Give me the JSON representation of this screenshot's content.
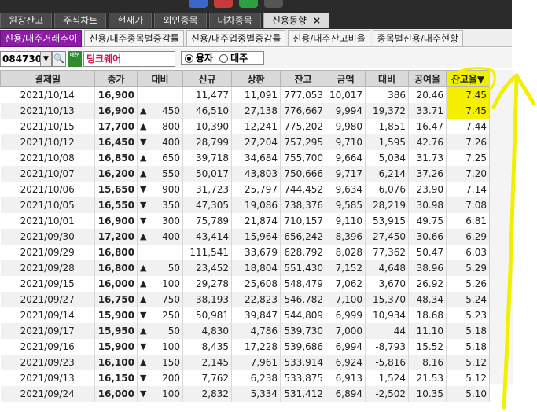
{
  "top_tabs": [
    {
      "label": "원장잔고",
      "active": false
    },
    {
      "label": "주식차트",
      "active": false
    },
    {
      "label": "현재가",
      "active": false
    },
    {
      "label": "외인종목",
      "active": false
    },
    {
      "label": "대차종목",
      "active": false
    },
    {
      "label": "신용동향",
      "active": true,
      "close": "×"
    }
  ],
  "sub_tabs": [
    {
      "label": "신용/대주거래추이",
      "active": true
    },
    {
      "label": "신용/대주종목별증감률",
      "active": false
    },
    {
      "label": "신용/대주업종별증감률",
      "active": false
    },
    {
      "label": "신용/대주잔고비율",
      "active": false
    },
    {
      "label": "종목별신용/대주현황",
      "active": false
    }
  ],
  "search": {
    "code": "084730",
    "dropdown_glyph": "▼",
    "search_glyph": "🔍",
    "badge_text": "배분",
    "stock_name": "팅크웨어",
    "radio_options": [
      {
        "label": "융자",
        "selected": true
      },
      {
        "label": "대주",
        "selected": false
      }
    ]
  },
  "table": {
    "headers": [
      "결제일",
      "종가",
      "대비",
      "신규",
      "상환",
      "잔고",
      "금액",
      "대비",
      "공여율",
      "잔고율▼"
    ],
    "rows": [
      {
        "date": "2021/10/14",
        "close": "16,900",
        "dir": "flat",
        "chg": "",
        "new": "11,477",
        "repay": "11,091",
        "bal": "777,053",
        "amt": "10,017",
        "amt_chg": "386",
        "amt_dir": "up",
        "supply": "20.46",
        "ratio": "7.45"
      },
      {
        "date": "2021/10/13",
        "close": "16,900",
        "dir": "up",
        "chg": "450",
        "new": "46,510",
        "repay": "27,138",
        "bal": "776,667",
        "amt": "9,994",
        "amt_chg": "19,372",
        "amt_dir": "up",
        "supply": "33.71",
        "ratio": "7.45"
      },
      {
        "date": "2021/10/15",
        "close": "17,700",
        "dir": "up",
        "chg": "800",
        "new": "10,390",
        "repay": "12,241",
        "bal": "775,202",
        "amt": "9,980",
        "amt_chg": "-1,851",
        "amt_dir": "down",
        "supply": "16.47",
        "ratio": "7.44"
      },
      {
        "date": "2021/10/12",
        "close": "16,450",
        "dir": "down",
        "chg": "400",
        "new": "28,799",
        "repay": "27,204",
        "bal": "757,295",
        "amt": "9,710",
        "amt_chg": "1,595",
        "amt_dir": "up",
        "supply": "42.76",
        "ratio": "7.26"
      },
      {
        "date": "2021/10/08",
        "close": "16,850",
        "dir": "up",
        "chg": "650",
        "new": "39,718",
        "repay": "34,684",
        "bal": "755,700",
        "amt": "9,664",
        "amt_chg": "5,034",
        "amt_dir": "up",
        "supply": "31.73",
        "ratio": "7.25"
      },
      {
        "date": "2021/10/07",
        "close": "16,200",
        "dir": "up",
        "chg": "550",
        "new": "50,017",
        "repay": "43,803",
        "bal": "750,666",
        "amt": "9,717",
        "amt_chg": "6,214",
        "amt_dir": "up",
        "supply": "37.26",
        "ratio": "7.20"
      },
      {
        "date": "2021/10/06",
        "close": "15,650",
        "dir": "down",
        "chg": "900",
        "new": "31,723",
        "repay": "25,797",
        "bal": "744,452",
        "amt": "9,634",
        "amt_chg": "6,076",
        "amt_dir": "up",
        "supply": "23.90",
        "ratio": "7.14"
      },
      {
        "date": "2021/10/05",
        "close": "16,550",
        "dir": "down",
        "chg": "350",
        "new": "47,305",
        "repay": "19,086",
        "bal": "738,376",
        "amt": "9,585",
        "amt_chg": "28,219",
        "amt_dir": "up",
        "supply": "30.98",
        "ratio": "7.08"
      },
      {
        "date": "2021/10/01",
        "close": "16,900",
        "dir": "down",
        "chg": "300",
        "new": "75,789",
        "repay": "21,874",
        "bal": "710,157",
        "amt": "9,110",
        "amt_chg": "53,915",
        "amt_dir": "up",
        "supply": "49.75",
        "ratio": "6.81"
      },
      {
        "date": "2021/09/30",
        "close": "17,200",
        "dir": "up",
        "chg": "400",
        "new": "43,414",
        "repay": "15,964",
        "bal": "656,242",
        "amt": "8,396",
        "amt_chg": "27,450",
        "amt_dir": "up",
        "supply": "30.66",
        "ratio": "6.29"
      },
      {
        "date": "2021/09/29",
        "close": "16,800",
        "dir": "flat",
        "chg": "",
        "new": "111,541",
        "repay": "33,679",
        "bal": "628,792",
        "amt": "8,028",
        "amt_chg": "77,362",
        "amt_dir": "up",
        "supply": "50.47",
        "ratio": "6.03"
      },
      {
        "date": "2021/09/28",
        "close": "16,800",
        "dir": "up",
        "chg": "50",
        "new": "23,452",
        "repay": "18,804",
        "bal": "551,430",
        "amt": "7,152",
        "amt_chg": "4,648",
        "amt_dir": "up",
        "supply": "38.96",
        "ratio": "5.29"
      },
      {
        "date": "2021/09/15",
        "close": "16,000",
        "dir": "up",
        "chg": "100",
        "new": "29,278",
        "repay": "25,608",
        "bal": "548,479",
        "amt": "7,062",
        "amt_chg": "3,670",
        "amt_dir": "up",
        "supply": "26.92",
        "ratio": "5.26"
      },
      {
        "date": "2021/09/27",
        "close": "16,750",
        "dir": "up",
        "chg": "750",
        "new": "38,193",
        "repay": "22,823",
        "bal": "546,782",
        "amt": "7,100",
        "amt_chg": "15,370",
        "amt_dir": "up",
        "supply": "48.34",
        "ratio": "5.24"
      },
      {
        "date": "2021/09/14",
        "close": "15,900",
        "dir": "down",
        "chg": "250",
        "new": "50,981",
        "repay": "39,847",
        "bal": "544,809",
        "amt": "6,999",
        "amt_chg": "10,934",
        "amt_dir": "up",
        "supply": "18.68",
        "ratio": "5.23"
      },
      {
        "date": "2021/09/17",
        "close": "15,950",
        "dir": "up",
        "chg": "50",
        "new": "4,830",
        "repay": "4,786",
        "bal": "539,730",
        "amt": "7,000",
        "amt_chg": "44",
        "amt_dir": "up",
        "supply": "11.10",
        "ratio": "5.18"
      },
      {
        "date": "2021/09/16",
        "close": "15,900",
        "dir": "down",
        "chg": "100",
        "new": "8,435",
        "repay": "17,228",
        "bal": "539,686",
        "amt": "6,994",
        "amt_chg": "-8,793",
        "amt_dir": "down",
        "supply": "15.52",
        "ratio": "5.18"
      },
      {
        "date": "2021/09/23",
        "close": "16,100",
        "dir": "up",
        "chg": "150",
        "new": "2,145",
        "repay": "7,961",
        "bal": "533,914",
        "amt": "6,924",
        "amt_chg": "-5,816",
        "amt_dir": "down",
        "supply": "8.16",
        "ratio": "5.12"
      },
      {
        "date": "2021/09/13",
        "close": "16,150",
        "dir": "down",
        "chg": "200",
        "new": "7,762",
        "repay": "6,238",
        "bal": "533,875",
        "amt": "6,913",
        "amt_chg": "1,524",
        "amt_dir": "up",
        "supply": "21.53",
        "ratio": "5.12"
      },
      {
        "date": "2021/09/24",
        "close": "16,000",
        "dir": "down",
        "chg": "100",
        "new": "2,832",
        "repay": "5,334",
        "bal": "531,412",
        "amt": "6,894",
        "amt_chg": "-2,502",
        "amt_dir": "down",
        "supply": "10.35",
        "ratio": "5.10"
      }
    ]
  },
  "glyphs": {
    "up": "▲",
    "down": "▼"
  },
  "colors": {
    "up": "#e01010",
    "down": "#1a55d8",
    "highlight": "#f5f000",
    "tab_active": "#8c1ba5",
    "annotation": "#f2f000"
  },
  "annotation": {
    "highlighted_column": "잔고율▼",
    "icon": "hand-drawn-arrow-icon"
  }
}
